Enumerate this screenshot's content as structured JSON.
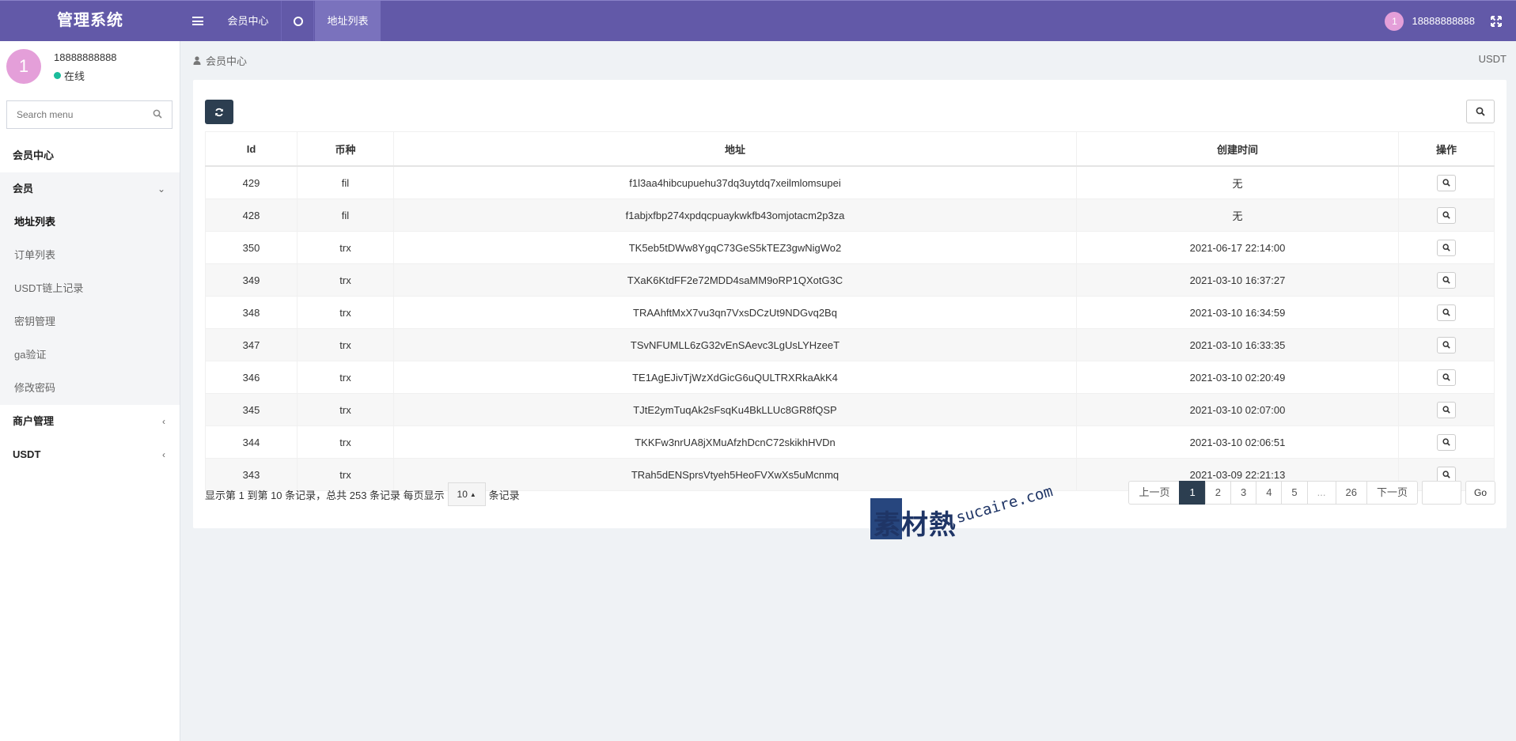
{
  "header": {
    "logo": "管理系统",
    "tabs": [
      {
        "label": "会员中心"
      },
      {
        "label": "地址列表"
      }
    ],
    "user": {
      "avatar_text": "1",
      "name": "18888888888"
    }
  },
  "sidebar": {
    "user": {
      "avatar_text": "1",
      "name": "18888888888",
      "status": "在线"
    },
    "search_placeholder": "Search menu",
    "menu": {
      "home": "会员中心",
      "member": {
        "label": "会员",
        "items": [
          "地址列表",
          "订单列表",
          "USDT链上记录",
          "密钥管理",
          "ga验证",
          "修改密码"
        ]
      },
      "merchant": "商户管理",
      "usdt": "USDT"
    }
  },
  "breadcrumb": {
    "current": "会员中心",
    "right": "USDT"
  },
  "table": {
    "columns": [
      "Id",
      "币种",
      "地址",
      "创建时间",
      "操作"
    ],
    "rows": [
      {
        "id": "429",
        "coin": "fil",
        "address": "f1l3aa4hibcupuehu37dq3uytdq7xeilmlomsupei",
        "created": "无"
      },
      {
        "id": "428",
        "coin": "fil",
        "address": "f1abjxfbp274xpdqcpuaykwkfb43omjotacm2p3za",
        "created": "无"
      },
      {
        "id": "350",
        "coin": "trx",
        "address": "TK5eb5tDWw8YgqC73GeS5kTEZ3gwNigWo2",
        "created": "2021-06-17 22:14:00"
      },
      {
        "id": "349",
        "coin": "trx",
        "address": "TXaK6KtdFF2e72MDD4saMM9oRP1QXotG3C",
        "created": "2021-03-10 16:37:27"
      },
      {
        "id": "348",
        "coin": "trx",
        "address": "TRAAhftMxX7vu3qn7VxsDCzUt9NDGvq2Bq",
        "created": "2021-03-10 16:34:59"
      },
      {
        "id": "347",
        "coin": "trx",
        "address": "TSvNFUMLL6zG32vEnSAevc3LgUsLYHzeeT",
        "created": "2021-03-10 16:33:35"
      },
      {
        "id": "346",
        "coin": "trx",
        "address": "TE1AgEJivTjWzXdGicG6uQULTRXRkaAkK4",
        "created": "2021-03-10 02:20:49"
      },
      {
        "id": "345",
        "coin": "trx",
        "address": "TJtE2ymTuqAk2sFsqKu4BkLLUc8GR8fQSP",
        "created": "2021-03-10 02:07:00"
      },
      {
        "id": "344",
        "coin": "trx",
        "address": "TKKFw3nrUA8jXMuAfzhDcnC72skikhHVDn",
        "created": "2021-03-10 02:06:51"
      },
      {
        "id": "343",
        "coin": "trx",
        "address": "TRah5dENSprsVtyeh5HeoFVXwXs5uMcnmq",
        "created": "2021-03-09 22:21:13"
      }
    ]
  },
  "footer": {
    "info": "显示第 1 到第 10 条记录，总共 253 条记录 每页显示",
    "page_size": "10",
    "suffix": "条记录"
  },
  "pagination": {
    "prev": "上一页",
    "pages": [
      "1",
      "2",
      "3",
      "4",
      "5",
      "...",
      "26"
    ],
    "active": "1",
    "next": "下一页",
    "go": "Go"
  },
  "watermark": {
    "brand": "素材熱",
    "url": "sucaire.com"
  },
  "colors": {
    "topbar": "#6259a8",
    "active_page": "#2c3e50",
    "status_online": "#1bbc9b",
    "avatar": "#e49fd9"
  }
}
